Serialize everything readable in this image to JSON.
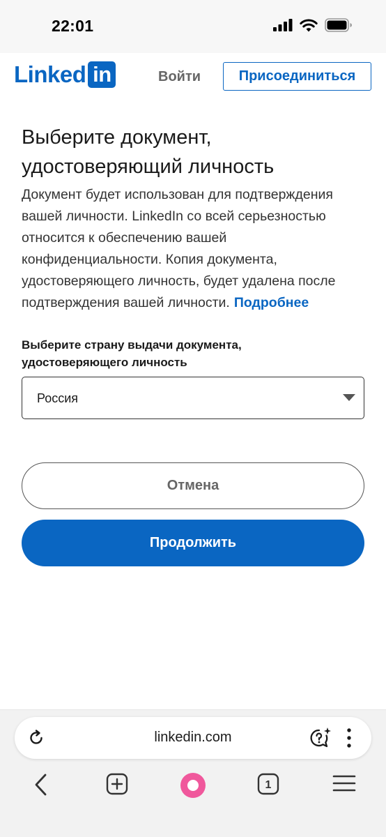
{
  "status_bar": {
    "time": "22:01",
    "icons": [
      "signal-icon",
      "wifi-icon",
      "battery-icon"
    ]
  },
  "header": {
    "logo_text": "Linked",
    "logo_box": "in",
    "signin_label": "Войти",
    "join_label": "Присоединиться"
  },
  "main": {
    "title": "Выберите документ, удостоверяющий личность",
    "description": "Документ будет использован для подтверждения вашей личности. LinkedIn со всей серьезностью относится к обеспечению вашей конфиденциальности. Копия документа, удостоверяющего личность, будет удалена после подтверждения вашей личности.",
    "learn_more": "Подробнее",
    "country_label": "Выберите страну выдачи документа, удостоверяющего личность",
    "country_value": "Россия",
    "cancel_label": "Отмена",
    "continue_label": "Продолжить"
  },
  "browser": {
    "url": "linkedin.com",
    "tab_count": "1",
    "icons": [
      "reload-icon",
      "assistant-icon",
      "more-icon",
      "back-icon",
      "new-tab-icon",
      "alice-icon",
      "tabs-icon",
      "menu-icon"
    ]
  },
  "colors": {
    "brand": "#0a66c2",
    "alice": "#f0589c"
  }
}
